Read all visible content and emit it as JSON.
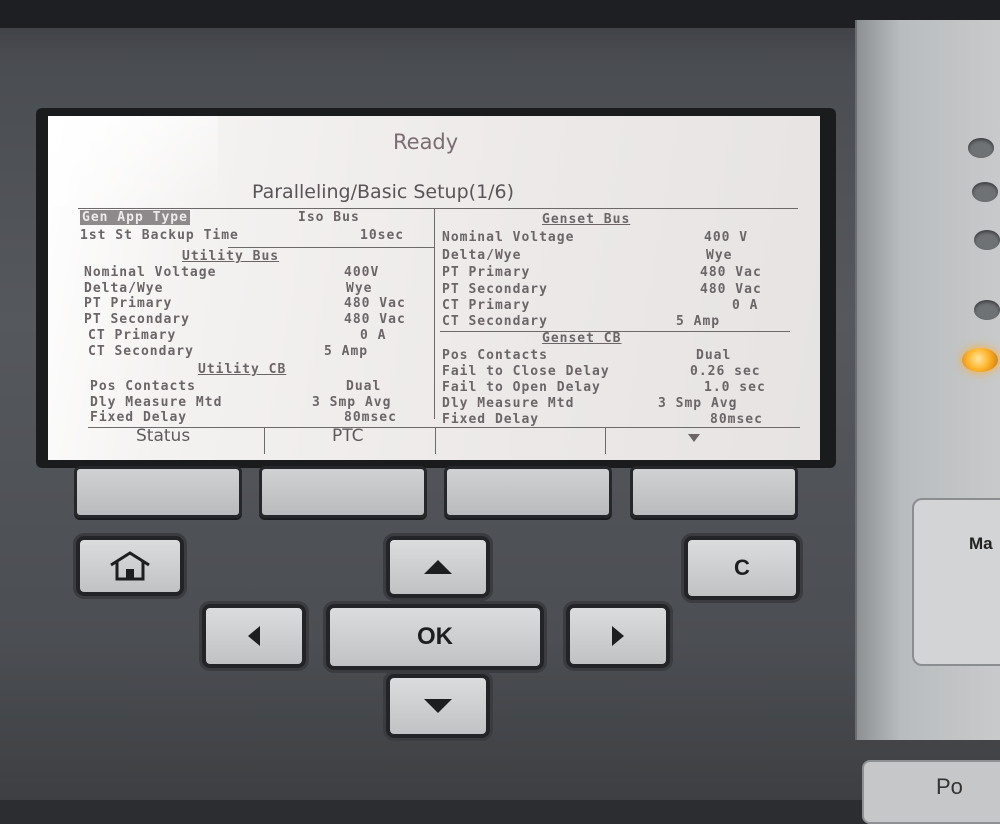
{
  "screen": {
    "status": "Ready",
    "page_title": "Paralleling/Basic Setup(1/6)",
    "left": {
      "rows_top": [
        {
          "label": "Gen App Type",
          "value": "Iso Bus"
        },
        {
          "label": "1st St Backup Time",
          "value": "10sec"
        }
      ],
      "utility_bus_title": "Utility Bus",
      "utility_bus": [
        {
          "label": "Nominal Voltage",
          "value": "400V"
        },
        {
          "label": "Delta/Wye",
          "value": "Wye"
        },
        {
          "label": "PT Primary",
          "value": "480 Vac"
        },
        {
          "label": "PT Secondary",
          "value": "480 Vac"
        },
        {
          "label": "CT Primary",
          "value": "0 A"
        },
        {
          "label": "CT Secondary",
          "value": "5 Amp"
        }
      ],
      "utility_cb_title": "Utility CB",
      "utility_cb": [
        {
          "label": "Pos Contacts",
          "value": "Dual"
        },
        {
          "label": "Dly Measure Mtd",
          "value": "3 Smp Avg"
        },
        {
          "label": "Fixed Delay",
          "value": "80msec"
        }
      ]
    },
    "right": {
      "genset_bus_title": "Genset Bus",
      "genset_bus": [
        {
          "label": "Nominal Voltage",
          "value": "400 V"
        },
        {
          "label": "Delta/Wye",
          "value": "Wye"
        },
        {
          "label": "PT Primary",
          "value": "480 Vac"
        },
        {
          "label": "PT Secondary",
          "value": "480 Vac"
        },
        {
          "label": "CT Primary",
          "value": "0 A"
        },
        {
          "label": "CT Secondary",
          "value": "5 Amp"
        }
      ],
      "genset_cb_title": "Genset CB",
      "genset_cb": [
        {
          "label": "Pos Contacts",
          "value": "Dual"
        },
        {
          "label": "Fail to Close Delay",
          "value": "0.26 sec"
        },
        {
          "label": "Fail to Open Delay",
          "value": "1.0 sec"
        },
        {
          "label": "Dly Measure Mtd",
          "value": "3 Smp Avg"
        },
        {
          "label": "Fixed Delay",
          "value": "80msec"
        }
      ]
    },
    "softkey_labels": [
      "Status",
      "PTC",
      "",
      "▼"
    ]
  },
  "keypad": {
    "ok_label": "OK",
    "clear_label": "C",
    "home_icon": "home-icon",
    "arrows": [
      "up",
      "down",
      "left",
      "right"
    ]
  },
  "side": {
    "button_label": "Ma",
    "bottom_button_label": "Po",
    "led_color": "#ffb52b"
  }
}
